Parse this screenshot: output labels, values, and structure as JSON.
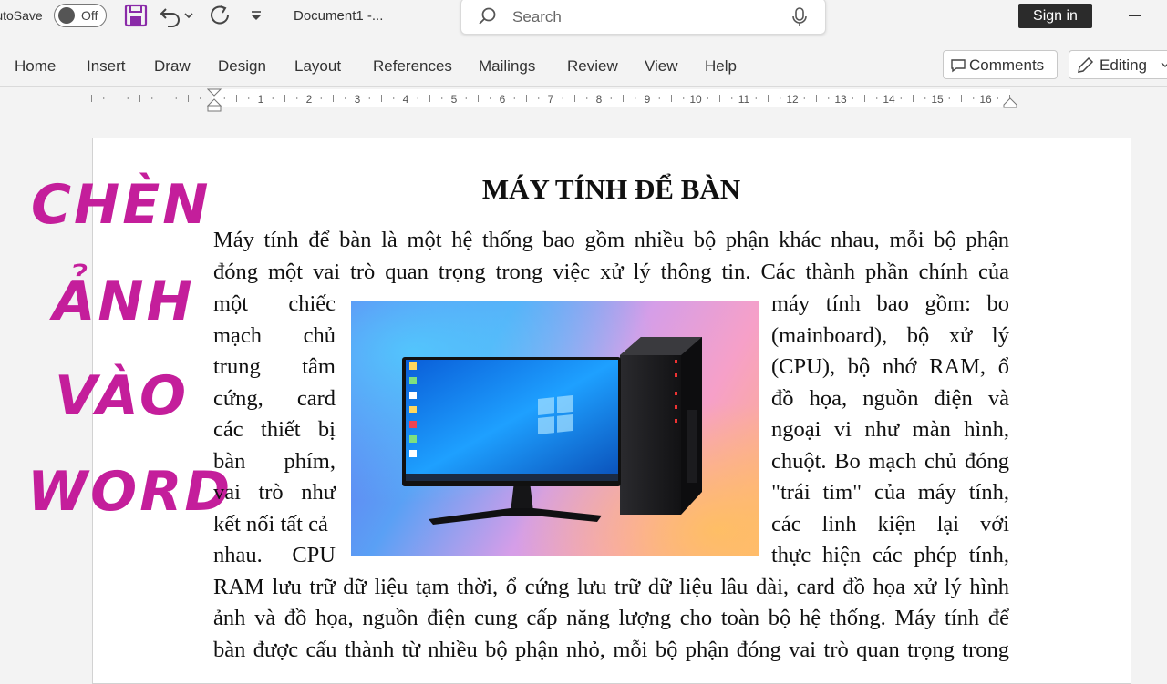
{
  "titlebar": {
    "autosave_label": "AutoSave",
    "autosave_state": "Off",
    "document_title": "Document1  -...",
    "search_placeholder": "Search",
    "signin_label": "Sign in"
  },
  "ribbon": {
    "tabs": [
      "Home",
      "Insert",
      "Draw",
      "Design",
      "Layout",
      "References",
      "Mailings",
      "Review",
      "View",
      "Help"
    ],
    "comments_label": "Comments",
    "editing_label": "Editing"
  },
  "ruler": {
    "numbers": [
      "1",
      "2",
      "3",
      "4",
      "5",
      "6",
      "7",
      "8",
      "9",
      "10",
      "11",
      "12",
      "13",
      "14",
      "15",
      "16"
    ]
  },
  "overlay": {
    "words": [
      "CHÈN",
      "ẢNH",
      "VÀO",
      "WORD"
    ]
  },
  "document": {
    "title": "MÁY TÍNH ĐỂ BÀN",
    "lines_full_top": [
      "Máy tính để bàn là một hệ thống bao gồm nhiều bộ phận khác nhau, mỗi bộ phận",
      "đóng một vai trò quan trọng trong việc xử lý thông tin. Các thành phần chính của"
    ],
    "lines_left": [
      "một chiếc",
      "mạch chủ",
      "trung tâm",
      "cứng, card",
      "các thiết bị",
      "bàn phím,",
      "vai trò như",
      "kết nối tất cả",
      "nhau. CPU"
    ],
    "lines_right": [
      "máy tính bao gồm: bo",
      "(mainboard), bộ xử lý",
      "(CPU), bộ nhớ RAM, ổ",
      "đồ họa, nguồn điện và",
      "ngoại vi như màn hình,",
      "chuột. Bo mạch chủ đóng",
      "\"trái tim\" của máy tính,",
      "các linh kiện lại với",
      "thực hiện các phép tính,"
    ],
    "lines_full_bottom": [
      "RAM lưu trữ dữ liệu tạm thời, ổ cứng lưu trữ dữ liệu lâu dài, card đồ họa xử lý hình",
      "ảnh và đồ họa, nguồn điện cung cấp năng lượng cho toàn bộ hệ thống. Máy tính để",
      "bàn được cấu thành từ nhiều bộ phận nhỏ, mỗi bộ phận đóng vai trò quan trọng trong"
    ]
  },
  "colors": {
    "accent_overlay": "#c41e9b",
    "save_icon": "#8a2aa8",
    "signin_bg": "#2b2b2b"
  }
}
